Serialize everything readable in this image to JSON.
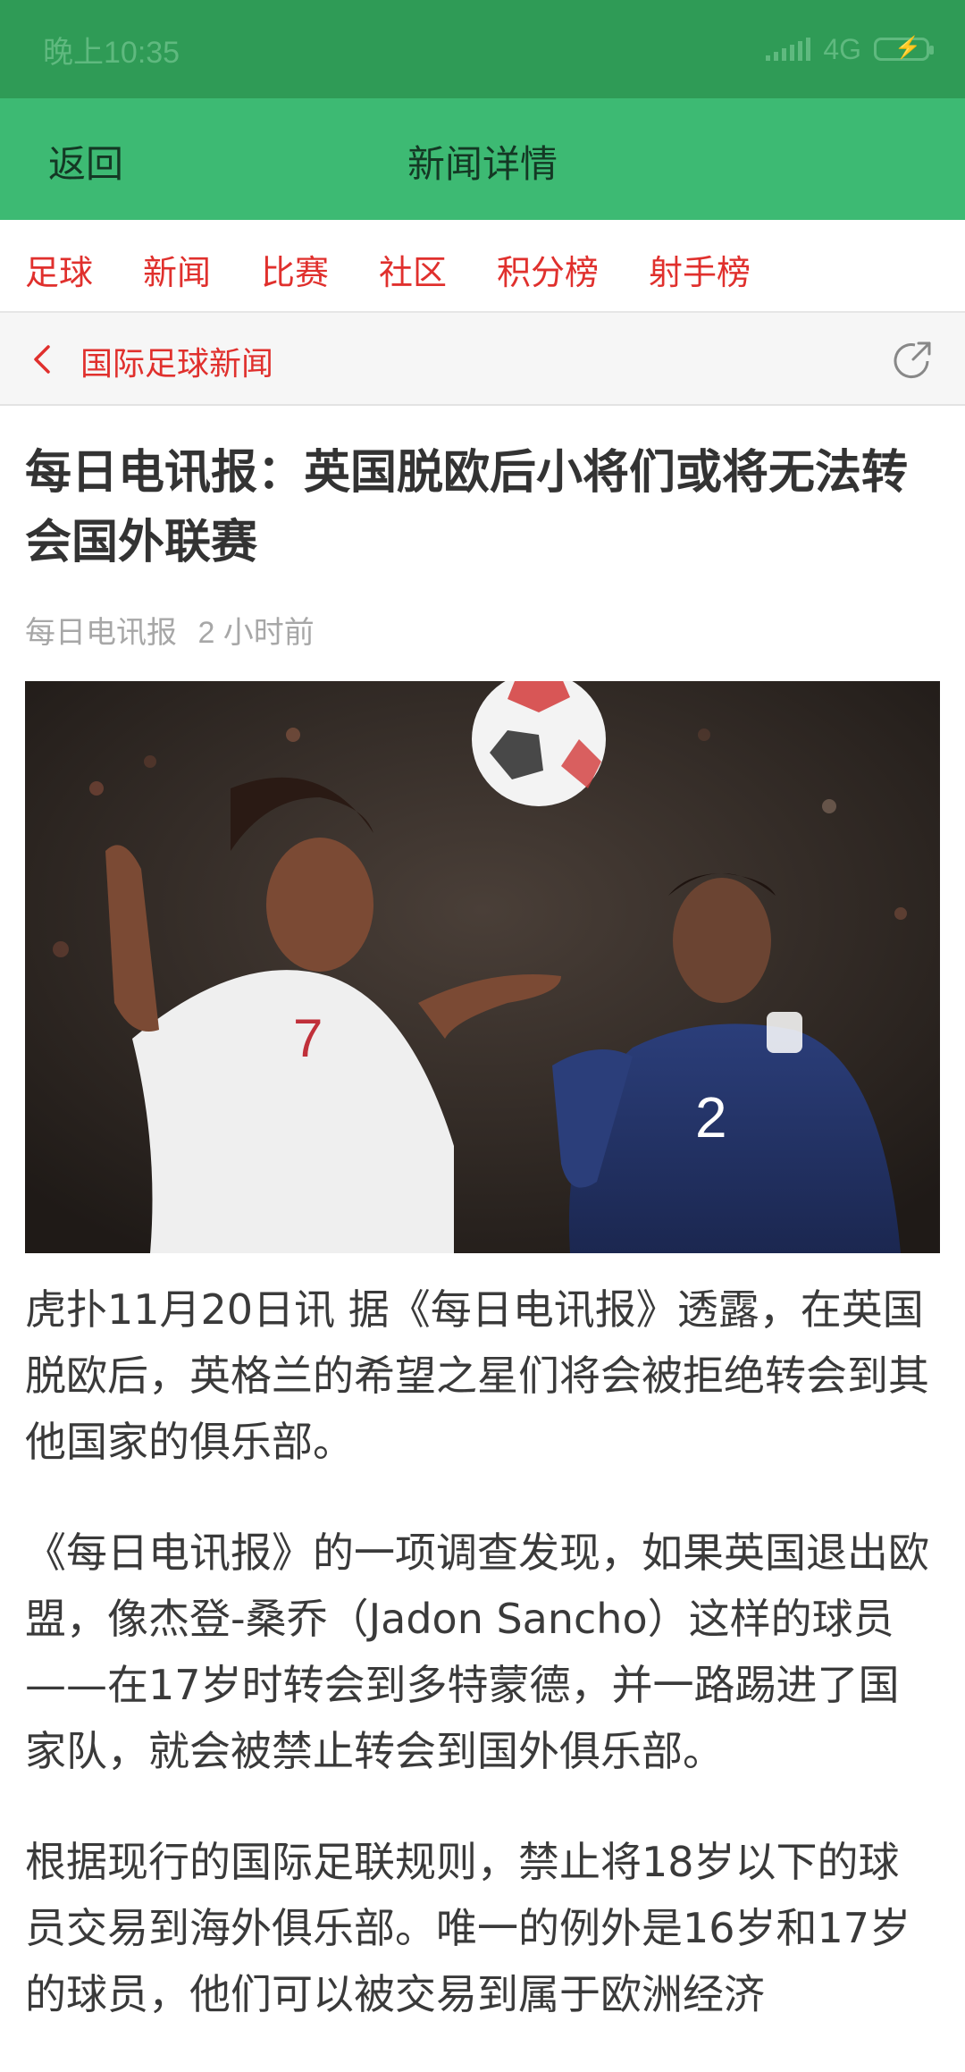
{
  "status_bar": {
    "time": "晚上10:35",
    "network": "4G"
  },
  "header": {
    "back_label": "返回",
    "title": "新闻详情"
  },
  "category_nav": [
    "足球",
    "新闻",
    "比赛",
    "社区",
    "积分榜",
    "射手榜"
  ],
  "sub_bar": {
    "title": "国际足球新闻",
    "back_icon": "chevron-left-icon",
    "share_icon": "share-icon"
  },
  "article": {
    "title": "每日电讯报：英国脱欧后小将们或将无法转会国外联赛",
    "source": "每日电讯报",
    "time_ago": "2 小时前",
    "paragraphs": [
      "虎扑11月20日讯 据《每日电讯报》透露，在英国脱欧后，英格兰的希望之星们将会被拒绝转会到其他国家的俱乐部。",
      "《每日电讯报》的一项调查发现，如果英国退出欧盟，像杰登-桑乔（Jadon Sancho）这样的球员——在17岁时转会到多特蒙德，并一路踢进了国家队，就会被禁止转会到国外俱乐部。",
      "根据现行的国际足联规则，禁止将18岁以下的球员交易到海外俱乐部。唯一的例外是16岁和17岁的球员，他们可以被交易到属于欧洲经济"
    ]
  },
  "colors": {
    "status_bar_bg": "#2f9b56",
    "header_bg": "#3dba73",
    "accent_red": "#e0302d",
    "meta_gray": "#a7a7a7"
  }
}
